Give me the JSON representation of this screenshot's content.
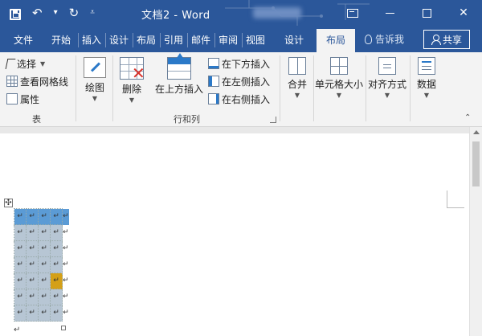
{
  "title_bar": {
    "doc_title": "文档2 - Word",
    "qat_icons": [
      "save-icon",
      "undo-icon",
      "dropdown-icon",
      "redo-icon",
      "customize-icon"
    ]
  },
  "tabs": [
    {
      "label": "文件"
    },
    {
      "label": "开始"
    },
    {
      "label": "插入"
    },
    {
      "label": "设计"
    },
    {
      "label": "布局"
    },
    {
      "label": "引用"
    },
    {
      "label": "邮件"
    },
    {
      "label": "审阅"
    },
    {
      "label": "视图"
    },
    {
      "label": "设计"
    },
    {
      "label": "布局",
      "active": true
    }
  ],
  "tell_me": "告诉我",
  "share": "共享",
  "ribbon": {
    "table_group": {
      "label": "表",
      "select": "选择",
      "view_gridlines": "查看网格线",
      "properties": "属性"
    },
    "draw": "绘图",
    "rows_cols_group": {
      "label": "行和列",
      "delete": "删除",
      "insert_above": "在上方插入",
      "insert_below": "在下方插入",
      "insert_left": "在左侧插入",
      "insert_right": "在右侧插入"
    },
    "merge": "合并",
    "cell_size": "单元格大小",
    "alignment": "对齐方式",
    "data": "数据"
  },
  "document": {
    "table_rows": 7,
    "table_cols": 4,
    "cell_mark": "↵",
    "move_handle": "✣",
    "paragraph_mark": "↵"
  },
  "colors": {
    "titlebar": "#2b579a",
    "selected_row": "#5b9bd5",
    "cell_shading": "#b7c6d4",
    "highlight_cell": "#d4a017"
  }
}
